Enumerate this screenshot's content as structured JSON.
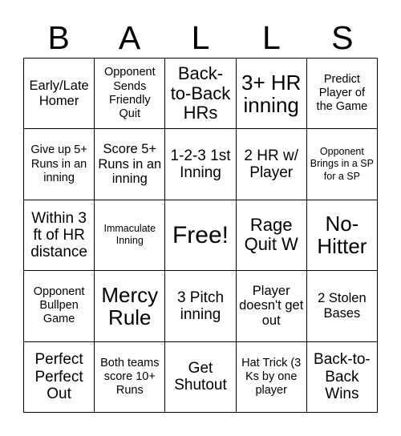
{
  "card": {
    "header_letters": [
      "B",
      "A",
      "L",
      "L",
      "S"
    ],
    "grid_size": "5x5",
    "colors": {
      "background": "#ffffff",
      "text": "#000000",
      "border": "#000000"
    },
    "rows": [
      [
        {
          "text": "Early/Late Homer",
          "size": "m"
        },
        {
          "text": "Opponent Sends Friendly Quit",
          "size": "s"
        },
        {
          "text": "Back-to-Back HRs",
          "size": "xl"
        },
        {
          "text": "3+ HR inning",
          "size": "xxl"
        },
        {
          "text": "Predict Player of the Game",
          "size": "s"
        }
      ],
      [
        {
          "text": "Give up 5+ Runs in an inning",
          "size": "s"
        },
        {
          "text": "Score 5+ Runs in an inning",
          "size": "m"
        },
        {
          "text": "1-2-3 1st Inning",
          "size": "l"
        },
        {
          "text": "2 HR w/ Player",
          "size": "l"
        },
        {
          "text": "Opponent Brings in a SP for a SP",
          "size": "xs"
        }
      ],
      [
        {
          "text": "Within 3 ft of HR distance",
          "size": "l"
        },
        {
          "text": "Immaculate Inning",
          "size": "xs"
        },
        {
          "text": "Free!",
          "size": "3xl"
        },
        {
          "text": "Rage Quit W",
          "size": "xl"
        },
        {
          "text": "No-Hitter",
          "size": "xxl"
        }
      ],
      [
        {
          "text": "Opponent Bullpen Game",
          "size": "s"
        },
        {
          "text": "Mercy Rule",
          "size": "xxl"
        },
        {
          "text": "3 Pitch inning",
          "size": "l"
        },
        {
          "text": "Player doesn't get out",
          "size": "m"
        },
        {
          "text": "2 Stolen Bases",
          "size": "m"
        }
      ],
      [
        {
          "text": "Perfect Perfect Out",
          "size": "l"
        },
        {
          "text": "Both teams score 10+ Runs",
          "size": "s"
        },
        {
          "text": "Get Shutout",
          "size": "l"
        },
        {
          "text": "Hat Trick (3 Ks by one player",
          "size": "s"
        },
        {
          "text": "Back-to-Back Wins",
          "size": "l"
        }
      ]
    ]
  }
}
